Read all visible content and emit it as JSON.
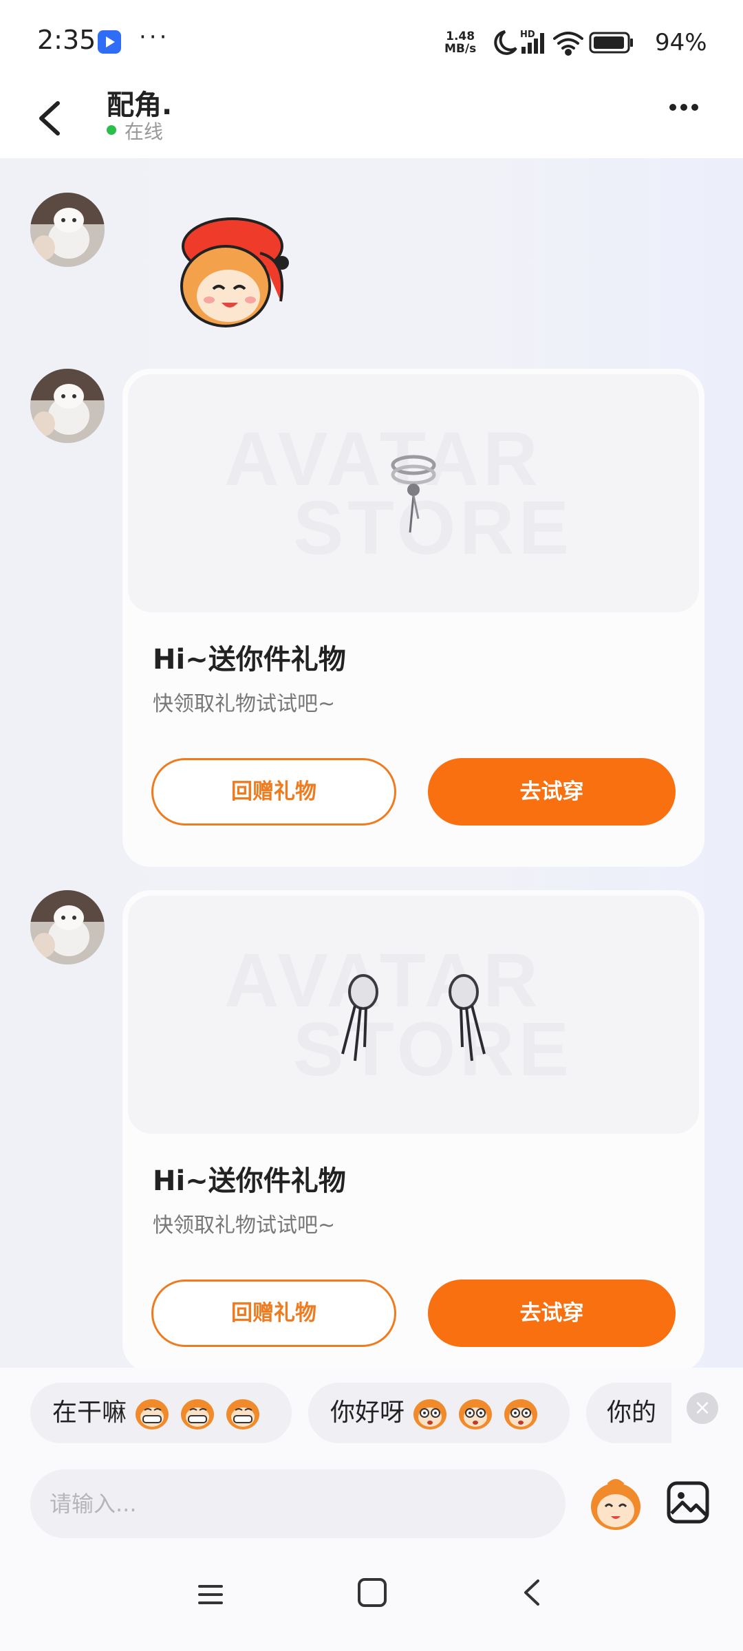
{
  "status_bar": {
    "time": "2:35",
    "dots": "···",
    "net_speed_value": "1.48",
    "net_speed_unit": "MB/s",
    "hd_label": "HD",
    "battery_percent": "94%"
  },
  "header": {
    "title": "配角.",
    "status": "在线"
  },
  "chat": {
    "gift_cards": [
      {
        "watermark_line1": "AVATAR",
        "watermark_line2": "STORE",
        "title": "Hi~送你件礼物",
        "subtitle": "快领取礼物试试吧~",
        "return_gift_label": "回赠礼物",
        "try_on_label": "去试穿"
      },
      {
        "watermark_line1": "AVATAR",
        "watermark_line2": "STORE",
        "title": "Hi~送你件礼物",
        "subtitle": "快领取礼物试试吧~",
        "return_gift_label": "回赠礼物",
        "try_on_label": "去试穿"
      }
    ]
  },
  "quick_replies": [
    {
      "text": "在干嘛",
      "emoji": "grin-monkey-icon"
    },
    {
      "text": "你好呀",
      "emoji": "wide-eye-monkey-icon"
    },
    {
      "text": "你的"
    }
  ],
  "input": {
    "placeholder": "请输入..."
  },
  "colors": {
    "accent": "#f8700f",
    "online": "#2bbf49",
    "background": "#f2f3f9"
  }
}
